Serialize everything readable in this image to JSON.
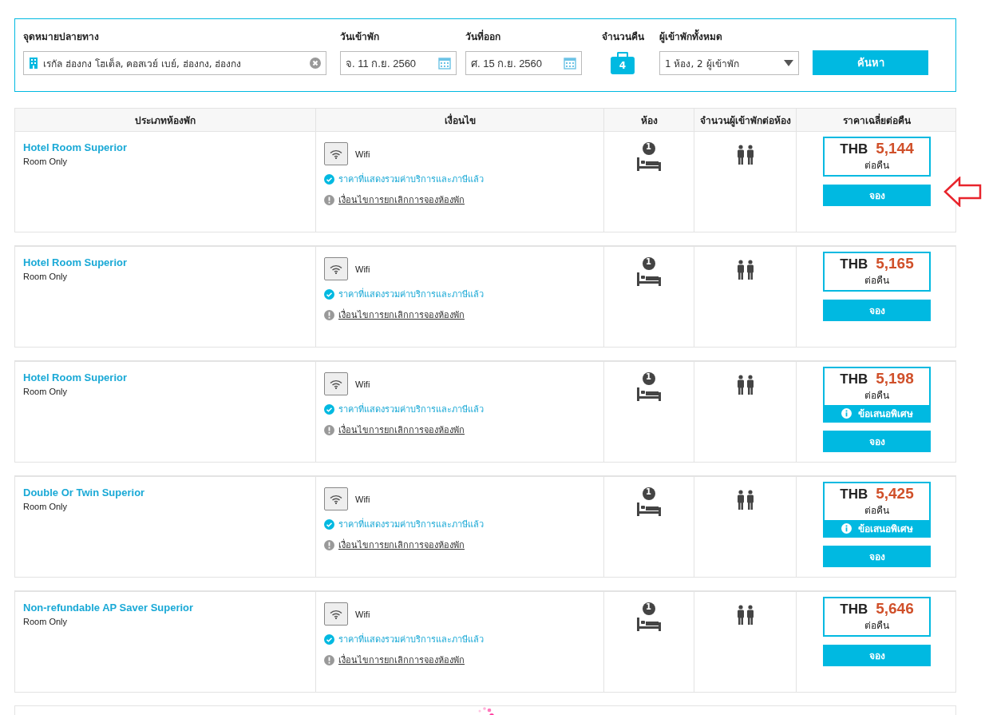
{
  "search": {
    "destination": {
      "label": "จุดหมายปลายทาง",
      "value": "เรกัล ฮ่องกง โฮเต็ล, คอสเวย์ เบย์, ฮ่องกง, ฮ่องกง"
    },
    "checkin": {
      "label": "วันเข้าพัก",
      "value": "จ. 11 ก.ย. 2560"
    },
    "checkout": {
      "label": "วันที่ออก",
      "value": "ศ. 15 ก.ย. 2560"
    },
    "nights": {
      "label": "จำนวนคืน",
      "value": "4"
    },
    "guests": {
      "label": "ผู้เข้าพักทั้งหมด",
      "value": "1 ห้อง, 2 ผู้เข้าพัก"
    },
    "button": "ค้นหา"
  },
  "table": {
    "columns": [
      "ประเภทห้องพัก",
      "เงื่อนไข",
      "ห้อง",
      "จำนวนผู้เข้าพักต่อห้อง",
      "ราคาเฉลี่ยต่อคืน"
    ],
    "rows": [
      {
        "name": "Hotel Room Superior",
        "board": "Room Only",
        "amenity": "Wifi",
        "tax_note": "ราคาที่แสดงรวมค่าบริการและภาษีแล้ว",
        "cancel_link": "เงื่อนไขการยกเลิกการจองห้องพัก",
        "rooms": "1",
        "currency": "THB",
        "price": "5,144",
        "per_night": "ต่อคืน",
        "special_offer": null,
        "book": "จอง",
        "pointer": true
      },
      {
        "name": "Hotel Room Superior",
        "board": "Room Only",
        "amenity": "Wifi",
        "tax_note": "ราคาที่แสดงรวมค่าบริการและภาษีแล้ว",
        "cancel_link": "เงื่อนไขการยกเลิกการจองห้องพัก",
        "rooms": "1",
        "currency": "THB",
        "price": "5,165",
        "per_night": "ต่อคืน",
        "special_offer": null,
        "book": "จอง",
        "pointer": false
      },
      {
        "name": "Hotel Room Superior",
        "board": "Room Only",
        "amenity": "Wifi",
        "tax_note": "ราคาที่แสดงรวมค่าบริการและภาษีแล้ว",
        "cancel_link": "เงื่อนไขการยกเลิกการจองห้องพัก",
        "rooms": "1",
        "currency": "THB",
        "price": "5,198",
        "per_night": "ต่อคืน",
        "special_offer": "ข้อเสนอพิเศษ",
        "book": "จอง",
        "pointer": false
      },
      {
        "name": "Double Or Twin Superior",
        "board": "Room Only",
        "amenity": "Wifi",
        "tax_note": "ราคาที่แสดงรวมค่าบริการและภาษีแล้ว",
        "cancel_link": "เงื่อนไขการยกเลิกการจองห้องพัก",
        "rooms": "1",
        "currency": "THB",
        "price": "5,425",
        "per_night": "ต่อคืน",
        "special_offer": "ข้อเสนอพิเศษ",
        "book": "จอง",
        "pointer": false
      },
      {
        "name": "Non-refundable AP Saver Superior",
        "board": "Room Only",
        "amenity": "Wifi",
        "tax_note": "ราคาที่แสดงรวมค่าบริการและภาษีแล้ว",
        "cancel_link": "เงื่อนไขการยกเลิกการจองห้องพัก",
        "rooms": "1",
        "currency": "THB",
        "price": "5,646",
        "per_night": "ต่อคืน",
        "special_offer": null,
        "book": "จอง",
        "pointer": false
      }
    ]
  },
  "loading": true
}
